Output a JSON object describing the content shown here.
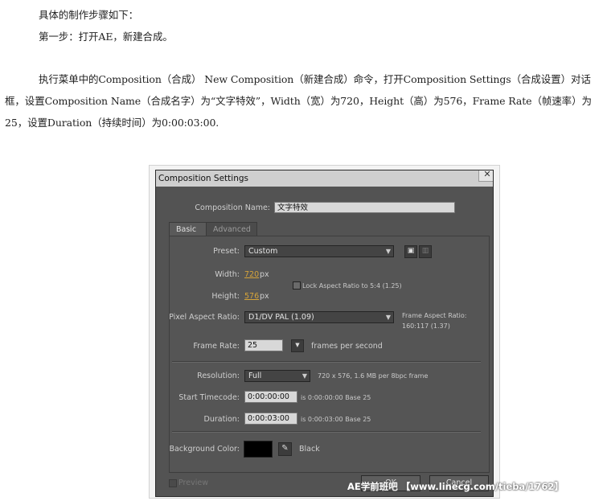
{
  "article": {
    "line1": "具体的制作步骤如下：",
    "line2": "第一步：打开AE，新建合成。",
    "para3": "执行菜单中的Composition（合成） New Composition（新建合成）命令，打开Composition Settings（合成设置）对话框，设置Composition Name（合成名字）为“文字特效”，Width（宽）为720，Height（高）为576，Frame Rate（帧速率）为25，设置Duration（持续时间）为0:00:03:00."
  },
  "dialog": {
    "title": "Composition Settings",
    "close_icon": "close-icon",
    "comp_name_label": "Composition Name:",
    "comp_name_value": "文字特效",
    "tabs": {
      "basic": "Basic",
      "advanced": "Advanced"
    },
    "preset": {
      "label": "Preset:",
      "value": "Custom",
      "save_icon": "save-preset-icon",
      "delete_icon": "trash-icon"
    },
    "width": {
      "label": "Width:",
      "value": "720",
      "unit": "px"
    },
    "height": {
      "label": "Height:",
      "value": "576",
      "unit": "px"
    },
    "lock_aspect": {
      "label": "Lock Aspect Ratio to 5:4 (1.25)",
      "checked": false
    },
    "pixel_aspect": {
      "label": "Pixel Aspect Ratio:",
      "value": "D1/DV PAL (1.09)"
    },
    "frame_aspect": {
      "label": "Frame Aspect Ratio:",
      "value": "160:117 (1.37)"
    },
    "frame_rate": {
      "label": "Frame Rate:",
      "value": "25",
      "unit": "frames per second"
    },
    "resolution": {
      "label": "Resolution:",
      "value": "Full",
      "info": "720 x 576, 1.6 MB per 8bpc frame"
    },
    "start_timecode": {
      "label": "Start Timecode:",
      "value": "0:00:00:00",
      "info": "is 0:00:00:00  Base 25"
    },
    "duration": {
      "label": "Duration:",
      "value": "0:00:03:00",
      "info": "is 0:00:03:00  Base 25"
    },
    "background_color": {
      "label": "Background Color:",
      "swatch": "#000000",
      "name": "Black",
      "eyedropper_icon": "eyedropper-icon"
    },
    "preview": {
      "label": "Preview"
    },
    "buttons": {
      "ok": "OK",
      "cancel": "Cancel"
    }
  },
  "watermark": "AE学前班吧 【www.linecg.com/tieba/1762】"
}
